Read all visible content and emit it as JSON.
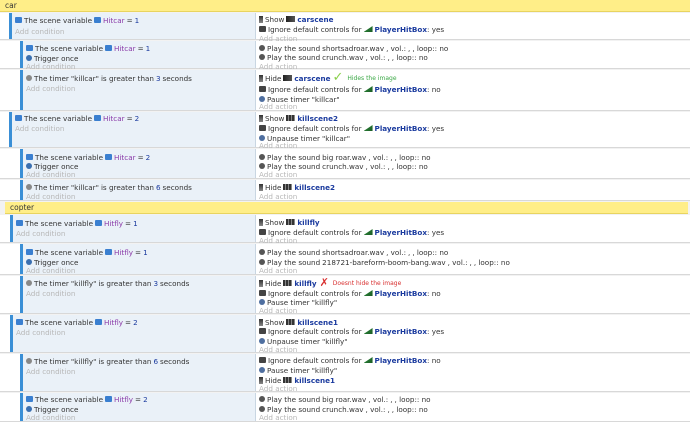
{
  "groups": {
    "car": "car",
    "copter": "copter"
  },
  "common": {
    "add_condition": "Add condition",
    "add_action": "Add action",
    "the_scene_variable": "The scene variable",
    "trigger_once": "Trigger once",
    "the_timer": "The timer",
    "is_greater_than": "is greater than",
    "seconds": "seconds",
    "show": "Show",
    "hide": "Hide",
    "ignore_default_controls_for": "Ignore default controls for",
    "play_the_sound": "Play the sound",
    "vol": ", vol.:",
    "loop": ", loop:",
    "pause_timer": "Pause timer",
    "unpause_timer": "Unpause timer"
  },
  "names": {
    "hitcar": "Hitcar",
    "hitfly": "Hitfly",
    "playerhitbox": "PlayerHitBox",
    "carscene": "carscene",
    "killscene2": "killscene2",
    "killfly": "killfly",
    "killscene1": "killscene1",
    "timer_killcar": "\"killcar\"",
    "timer_killfly": "\"killfly\"",
    "eq": "=",
    "one": "1",
    "two": "2",
    "three": "3",
    "six": "6",
    "yes": ": yes",
    "no": ": no",
    "comma": ",",
    "sound_shortsadroar": "shortsadroar.wav",
    "sound_crunch": "crunch.wav",
    "sound_bigroar": "big roar.wav",
    "sound_boom": "218721-bareform-boom-bang.wav"
  },
  "annotations": {
    "hides_the_image": "Hides the image",
    "doesnt_hide": "Doesnt hide the image",
    "check": "✓",
    "cross": "✗"
  },
  "colors": {
    "group_header": "#ffee88",
    "event_bar": "#3a8fd6",
    "variable": "#8a3aa8",
    "object": "#1a3a9e"
  }
}
